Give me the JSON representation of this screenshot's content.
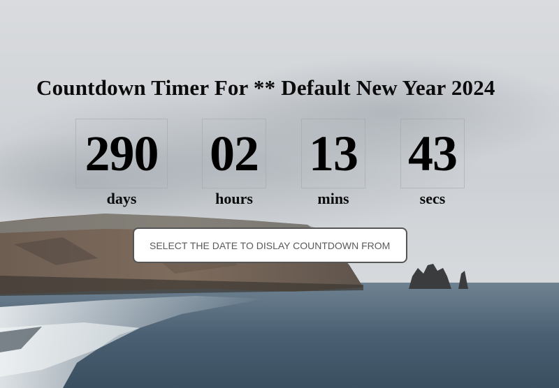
{
  "title": "Countdown Timer For ** Default New Year 2024",
  "countdown": {
    "days": {
      "value": "290",
      "label": "days"
    },
    "hours": {
      "value": "02",
      "label": "hours"
    },
    "mins": {
      "value": "13",
      "label": "mins"
    },
    "secs": {
      "value": "43",
      "label": "secs"
    }
  },
  "date_input": {
    "placeholder": "SELECT THE DATE TO DISLAY COUNTDOWN FROM"
  },
  "colors": {
    "sky": "#d4d7db",
    "sea": "#3e5566",
    "cliff": "#6b5a4c",
    "text": "#000000"
  }
}
